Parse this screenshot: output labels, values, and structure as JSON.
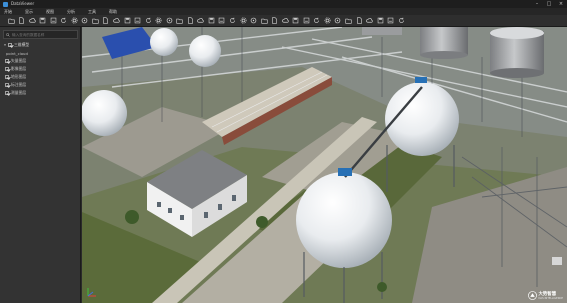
{
  "window": {
    "title": "DataViewer"
  },
  "menu": [
    {
      "label": "开始"
    },
    {
      "label": "显示"
    },
    {
      "label": "视图"
    },
    {
      "label": "分析"
    },
    {
      "label": "工具"
    },
    {
      "label": "帮助"
    }
  ],
  "toolbar": {
    "buttons": [
      {
        "icon": "folder-open-icon"
      },
      {
        "icon": "open-file-icon"
      },
      {
        "icon": "cloud-icon"
      },
      {
        "icon": "save-icon"
      },
      {
        "icon": "save-as-icon"
      },
      {
        "icon": "refresh-icon"
      },
      {
        "icon": "settings-icon"
      },
      {
        "icon": "target-icon"
      },
      {
        "icon": "copy-icon"
      },
      {
        "icon": "paste-icon"
      },
      {
        "icon": "sun-icon"
      },
      {
        "icon": "box-icon"
      },
      {
        "icon": "layers-icon"
      },
      {
        "icon": "window-icon"
      },
      {
        "icon": "cube-icon"
      },
      {
        "icon": "camera-icon"
      },
      {
        "icon": "crop-icon"
      },
      {
        "icon": "chart-icon"
      },
      {
        "icon": "link-icon"
      },
      {
        "icon": "grid-icon"
      },
      {
        "icon": "tag-icon"
      },
      {
        "icon": "play-icon"
      },
      {
        "icon": "plus-icon"
      },
      {
        "icon": "lasso-icon"
      },
      {
        "icon": "wave-icon"
      },
      {
        "icon": "measure-icon"
      },
      {
        "icon": "eye-icon"
      },
      {
        "icon": "circle-icon"
      },
      {
        "icon": "diamond-icon"
      },
      {
        "icon": "list-icon"
      },
      {
        "icon": "eraser-icon"
      },
      {
        "icon": "scan-icon"
      },
      {
        "icon": "document-icon"
      },
      {
        "icon": "edit-icon"
      },
      {
        "icon": "image-icon"
      },
      {
        "icon": "export-icon"
      },
      {
        "icon": "grid-small-icon"
      },
      {
        "icon": "search-icon"
      }
    ]
  },
  "search": {
    "placeholder": "输入查询的数据名称"
  },
  "tree": {
    "root": {
      "label": "三维模型",
      "expanded": true,
      "checked": true
    },
    "items": [
      {
        "label": "point_cloud",
        "checked": false
      },
      {
        "label": "矢量图层",
        "checked": true
      },
      {
        "label": "影像图层",
        "checked": true
      },
      {
        "label": "地形图层",
        "checked": true
      },
      {
        "label": "标注图层",
        "checked": true
      },
      {
        "label": "测量图层",
        "checked": true
      }
    ]
  },
  "watermark": {
    "name": "大势智慧",
    "tagline": "DAS INTELLIGENCE"
  },
  "colors": {
    "accent": "#3c8fd8",
    "background": "#2b2b2b"
  }
}
